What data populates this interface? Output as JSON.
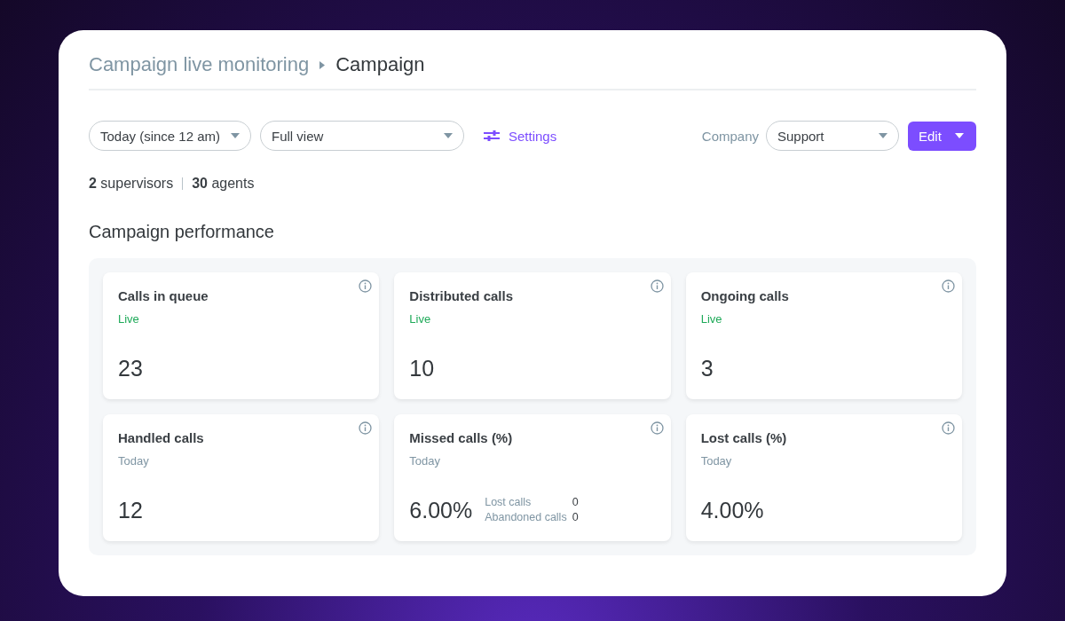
{
  "breadcrumb": {
    "parent": "Campaign live monitoring",
    "current": "Campaign"
  },
  "toolbar": {
    "period": "Today (since 12 am)",
    "view": "Full view",
    "settings": "Settings",
    "company_label": "Company",
    "company": "Support",
    "edit": "Edit"
  },
  "counts": [
    "**2** supervisors",
    "**30** agents"
  ],
  "section_title": "Campaign performance",
  "tiles": [
    {
      "title": "Calls in queue",
      "period": "Live",
      "kind": "live",
      "value": "23"
    },
    {
      "title": "Distributed calls",
      "period": "Live",
      "kind": "live",
      "value": "10"
    },
    {
      "title": "Ongoing calls",
      "period": "Live",
      "kind": "live",
      "value": "3"
    },
    {
      "title": "Handled calls",
      "period": "Today",
      "kind": "today",
      "value": "12"
    },
    {
      "title": "Missed calls (%)",
      "period": "Today",
      "kind": "today",
      "value": "6.00%",
      "details": [
        {
          "label": "Lost calls",
          "value": "0"
        },
        {
          "label": "Abandoned calls",
          "value": "0"
        }
      ]
    },
    {
      "title": "Lost calls (%)",
      "period": "Today",
      "kind": "today",
      "value": "4.00%"
    }
  ]
}
